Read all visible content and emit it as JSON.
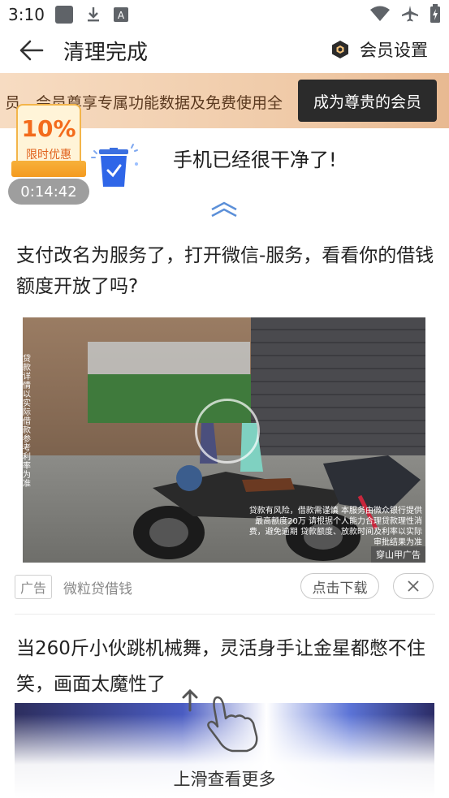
{
  "status_bar": {
    "time": "3:10",
    "icons": [
      "gallery-icon",
      "download-icon",
      "font-icon",
      "wifi-icon",
      "airplane-icon",
      "battery-icon"
    ]
  },
  "header": {
    "title": "清理完成",
    "member_settings_label": "会员设置"
  },
  "promo": {
    "text": "员、会员尊享专属功能数据及免费使用全",
    "button_label": "成为尊贵的会员"
  },
  "clean_result": {
    "badge_percent": "10%",
    "badge_subtitle": "限时优惠",
    "countdown": "0:14:42",
    "message": "手机已经很干净了!"
  },
  "feed": {
    "article1": {
      "title": "支付改名为服务了，打开微信-服务，看看你的借钱额度开放了吗?",
      "ad_fineprint": "贷款有风险，借款需谨慎 本服务由微众银行提供 最高额度20万 请根据个人能力合理贷款理性消费，避免逾期 贷款额度、放款时间及利率以实际审批结果为准",
      "ad_vertical": "贷款详情以实际借款参考利率为准",
      "ad_source": "穿山甲广告",
      "tag": "广告",
      "advertiser": "微粒贷借钱",
      "download_label": "点击下载"
    },
    "article2": {
      "title": "当260斤小伙跳机械舞，灵活身手让金星都憋不住笑，画面太魔性了"
    }
  },
  "swipe_hint": "上滑查看更多",
  "colors": {
    "promo_bg": "#efc9a6",
    "promo_button": "#2b2b2b",
    "badge_orange": "#f36b1c",
    "countdown_bg": "#9e9e9e",
    "chevron_blue": "#5b8fd8"
  }
}
